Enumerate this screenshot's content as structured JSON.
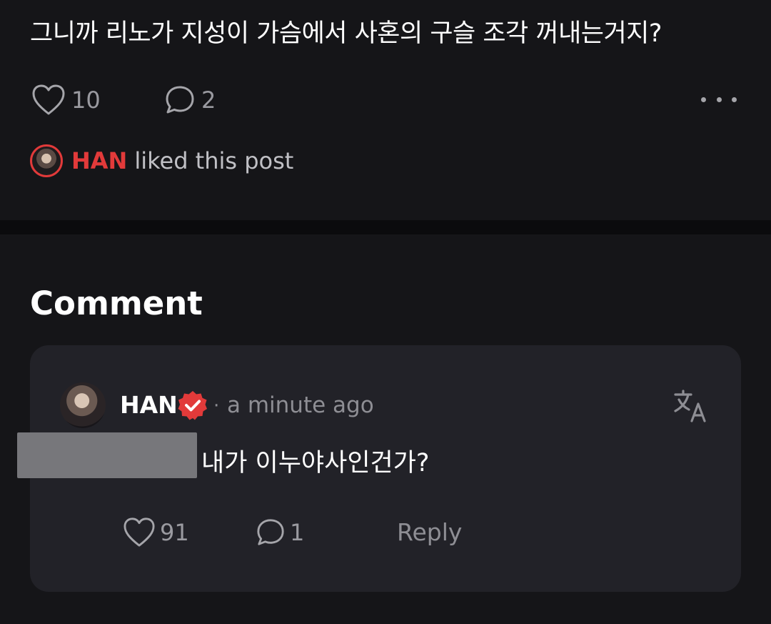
{
  "post": {
    "text": "그니까 리노가 지성이 가슴에서 사혼의 구슬 조각 꺼내는거지?",
    "likes": "10",
    "comments": "2",
    "liked_by": {
      "name": "HAN",
      "text": "liked this post"
    }
  },
  "comment_section": {
    "heading": "Comment",
    "comment": {
      "author": "HAN",
      "time": "a minute ago",
      "separator": "·",
      "text": "내가 이누야사인건가?",
      "likes": "91",
      "replies": "1",
      "reply_label": "Reply"
    }
  },
  "icons": {
    "like": "heart-outline-icon",
    "comment": "chat-bubble-icon",
    "more": "more-horizontal-icon",
    "verified": "verified-badge-icon",
    "translate": "translate-icon"
  },
  "colors": {
    "background": "#151518",
    "card": "#222228",
    "accent": "#e23a3a",
    "muted_text": "#9a9aa0"
  }
}
